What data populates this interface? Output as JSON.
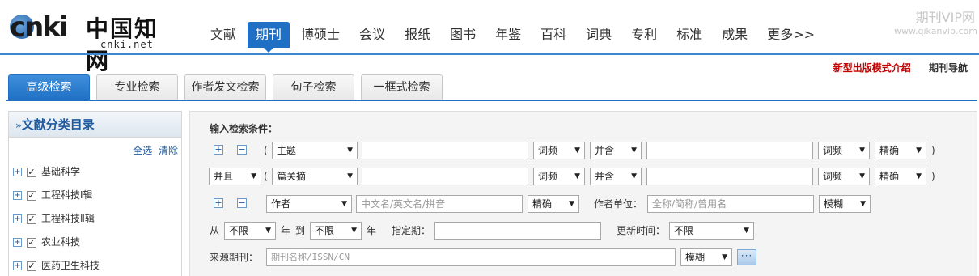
{
  "header": {
    "logo_text": "cnki",
    "logo_cn": "中国知网",
    "logo_url": "cnki.net",
    "watermark_title": "期刊VIP网",
    "watermark_url": "www.qikanvip.com"
  },
  "nav": {
    "items": [
      "文献",
      "期刊",
      "博硕士",
      "会议",
      "报纸",
      "图书",
      "年鉴",
      "百科",
      "词典",
      "专利",
      "标准",
      "成果",
      "更多>>"
    ],
    "active_index": 1
  },
  "right_links": {
    "intro": "新型出版模式介绍",
    "journal_nav": "期刊导航"
  },
  "tabs": [
    "高级检索",
    "专业检索",
    "作者发文检索",
    "句子检索",
    "一框式检索"
  ],
  "sidebar": {
    "title": "文献分类目录",
    "title_prefix": "»",
    "select_all": "全选",
    "clear": "清除",
    "categories": [
      "基础科学",
      "工程科技Ⅰ辑",
      "工程科技Ⅱ辑",
      "农业科技",
      "医药卫生科技"
    ]
  },
  "search": {
    "label": "输入检索条件：",
    "row1": {
      "field": "主题",
      "freq1": "词频",
      "op": "并含",
      "freq2": "词频",
      "match": "精确"
    },
    "row2": {
      "logic": "并且",
      "field": "篇关摘",
      "freq1": "词频",
      "op": "并含",
      "freq2": "词频",
      "match": "精确"
    },
    "row3": {
      "field": "作者",
      "placeholder": "中文名/英文名/拼音",
      "match": "精确",
      "unit_label": "作者单位：",
      "unit_placeholder": "全称/简称/曾用名",
      "unit_match": "模糊"
    },
    "row4": {
      "from": "从",
      "year_from": "不限",
      "year": "年",
      "to": "到",
      "year_to": "不限",
      "year2": "年",
      "period_label": "指定期：",
      "update_label": "更新时间：",
      "update_value": "不限"
    },
    "row5": {
      "source_label": "来源期刊：",
      "placeholder": "期刊名称/ISSN/CN",
      "match": "模糊",
      "more": "···"
    },
    "paren_open": "(",
    "paren_close": ")",
    "plus": "+",
    "minus": "−"
  }
}
